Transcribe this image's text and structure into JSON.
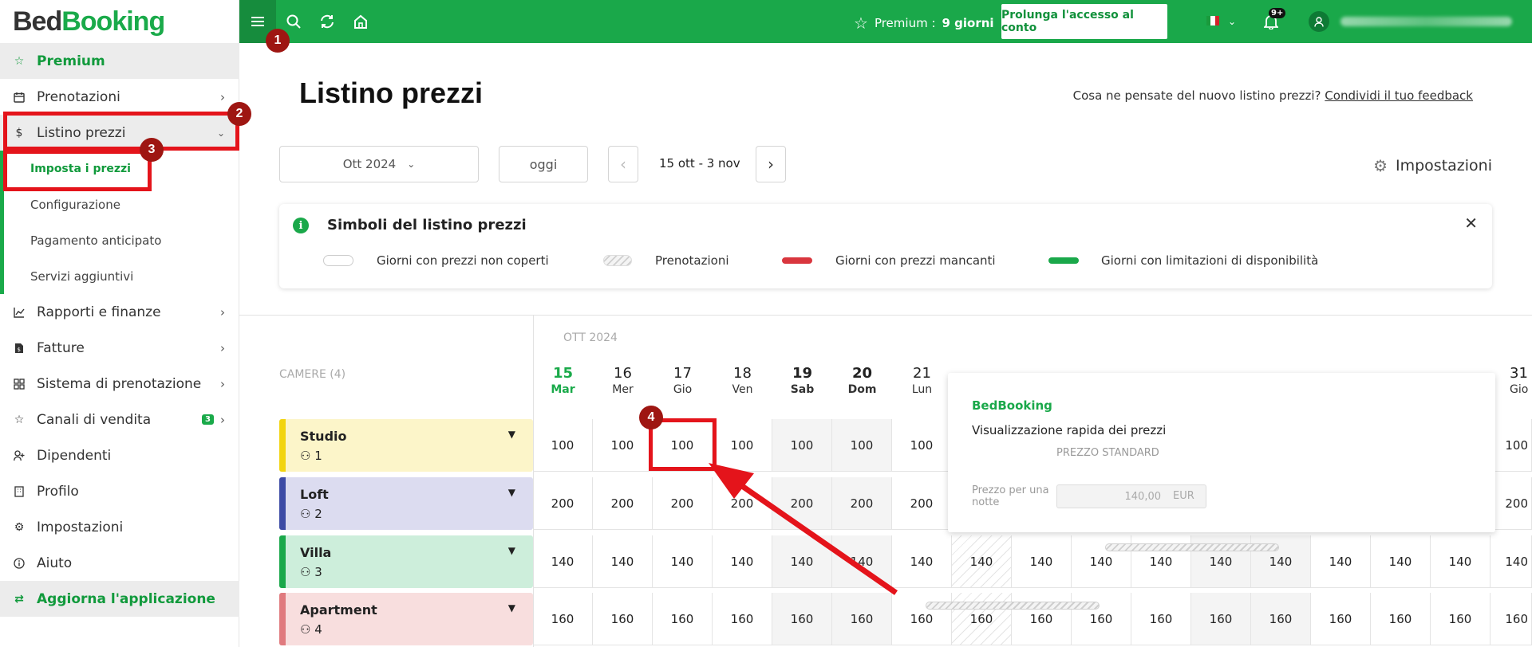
{
  "app": {
    "logo_part1": "Bed",
    "logo_part2": "Booking"
  },
  "sidebar": {
    "premium": "Premium",
    "items": {
      "prenotazioni": "Prenotazioni",
      "listino": "Listino prezzi",
      "rapporti": "Rapporti e finanze",
      "fatture": "Fatture",
      "sistema": "Sistema di prenotazione",
      "canali": "Canali di vendita",
      "canali_badge": "3",
      "dipendenti": "Dipendenti",
      "profilo": "Profilo",
      "impostazioni": "Impostazioni",
      "aiuto": "Aiuto",
      "aggiorna": "Aggiorna l'applicazione"
    },
    "sub": {
      "imposta": "Imposta i prezzi",
      "configurazione": "Configurazione",
      "pagamento": "Pagamento anticipato",
      "servizi": "Servizi aggiuntivi"
    }
  },
  "topbar": {
    "premium_label": "Premium :",
    "premium_days": "9 giorni",
    "extend_button": "Prolunga l'accesso al conto",
    "notifications_badge": "9+"
  },
  "main": {
    "title": "Listino prezzi",
    "feedback_text": "Cosa ne pensate del nuovo listino prezzi?",
    "feedback_link": "Condividi il tuo feedback",
    "month_select": "Ott 2024",
    "today_button": "oggi",
    "date_range": "15 ott - 3 nov",
    "settings": "Impostazioni"
  },
  "legend": {
    "title": "Simboli del listino prezzi",
    "items": {
      "uncovered": "Giorni con prezzi non coperti",
      "bookings": "Prenotazioni",
      "missing": "Giorni con prezzi mancanti",
      "limited": "Giorni con limitazioni di disponibilità"
    }
  },
  "grid": {
    "month_label": "OTT 2024",
    "rooms_header": "CAMERE (4)",
    "days": [
      {
        "num": "15",
        "wd": "Mar"
      },
      {
        "num": "16",
        "wd": "Mer"
      },
      {
        "num": "17",
        "wd": "Gio"
      },
      {
        "num": "18",
        "wd": "Ven"
      },
      {
        "num": "19",
        "wd": "Sab"
      },
      {
        "num": "20",
        "wd": "Dom"
      },
      {
        "num": "21",
        "wd": "Lun"
      },
      {
        "num": "31",
        "wd": "Gio"
      }
    ],
    "rooms": [
      {
        "name": "Studio",
        "occupancy": "1",
        "prices": [
          "100",
          "100",
          "100",
          "100",
          "100",
          "100",
          "100",
          "100"
        ]
      },
      {
        "name": "Loft",
        "occupancy": "2",
        "prices": [
          "200",
          "200",
          "200",
          "200",
          "200",
          "200",
          "200",
          "200"
        ]
      },
      {
        "name": "Villa",
        "occupancy": "3",
        "prices": [
          "140",
          "140",
          "140",
          "140",
          "140",
          "140",
          "140",
          "140",
          "140",
          "140",
          "140",
          "140",
          "140",
          "140",
          "140",
          "140",
          "140"
        ]
      },
      {
        "name": "Apartment",
        "occupancy": "4",
        "prices": [
          "160",
          "160",
          "160",
          "160",
          "160",
          "160",
          "160",
          "160",
          "160",
          "160",
          "160",
          "160",
          "160",
          "160",
          "160",
          "160",
          "160"
        ]
      }
    ]
  },
  "popup": {
    "brand": "BedBooking",
    "title": "Visualizzazione rapida dei prezzi",
    "column": "PREZZO STANDARD",
    "label": "Prezzo per una notte",
    "value": "140,00",
    "currency": "EUR"
  },
  "annotations": {
    "m1": "1",
    "m2": "2",
    "m3": "3",
    "m4": "4"
  },
  "colors": {
    "brand_green": "#1aa84a",
    "highlight_red": "#e4141b",
    "marker_red": "#9e1612"
  }
}
